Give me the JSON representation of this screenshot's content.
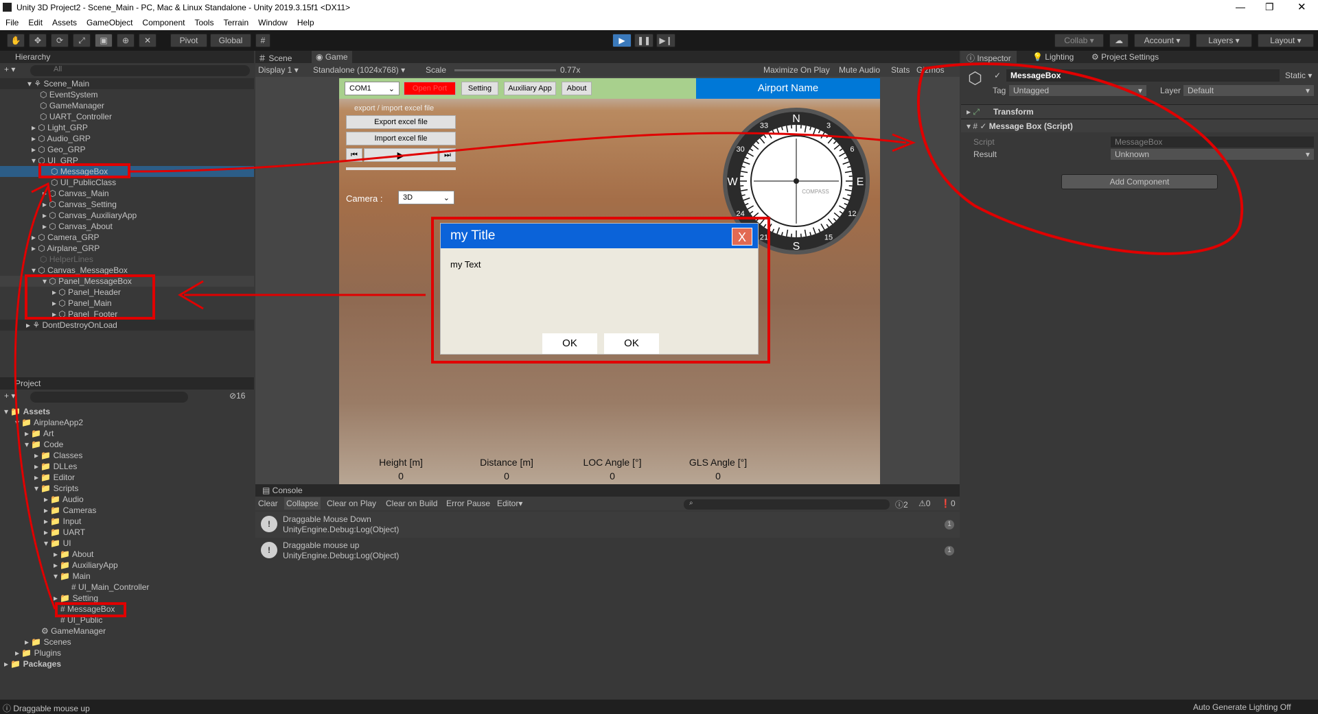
{
  "window": {
    "title": "Unity 3D Project2 - Scene_Main - PC, Mac & Linux Standalone - Unity 2019.3.15f1 <DX11>"
  },
  "menu": [
    "File",
    "Edit",
    "Assets",
    "GameObject",
    "Component",
    "Tools",
    "Terrain",
    "Window",
    "Help"
  ],
  "toolbar": {
    "pivot": "Pivot",
    "global": "Global",
    "collab": "Collab ▾",
    "account": "Account",
    "layers": "Layers",
    "layout": "Layout"
  },
  "hierarchy": {
    "title": "Hierarchy",
    "search": "All",
    "scene": "Scene_Main",
    "items": [
      "EventSystem",
      "GameManager",
      "UART_Controller",
      "Light_GRP",
      "Audio_GRP",
      "Geo_GRP",
      "UI_GRP",
      "MessageBox",
      "UI_PublicClass",
      "Canvas_Main",
      "Canvas_Setting",
      "Canvas_AuxiliaryApp",
      "Canvas_About",
      "Camera_GRP",
      "Airplane_GRP",
      "HelperLines",
      "Canvas_MessageBox",
      "Panel_MessageBox",
      "Panel_Header",
      "Panel_Main",
      "Panel_Footer"
    ],
    "dontdestroy": "DontDestroyOnLoad"
  },
  "project": {
    "title": "Project",
    "count": "16",
    "items": [
      "Assets",
      "AirplaneApp2",
      "Art",
      "Code",
      "Classes",
      "DLLes",
      "Editor",
      "Scripts",
      "Audio",
      "Cameras",
      "Input",
      "UART",
      "UI",
      "About",
      "AuxiliaryApp",
      "Main",
      "UI_Main_Controller",
      "Setting",
      "MessageBox",
      "UI_Public",
      "GameManager",
      "Scenes",
      "Plugins",
      "Packages"
    ]
  },
  "game": {
    "tab_scene": "Scene",
    "tab_game": "Game",
    "display": "Display 1",
    "resolution": "Standalone (1024x768)",
    "scale_label": "Scale",
    "scale_value": "0.77x",
    "maximize": "Maximize On Play",
    "mute": "Mute Audio",
    "stats": "Stats",
    "gizmos": "Gizmos",
    "com": "COM1",
    "open_port": "Open Port",
    "setting": "Setting",
    "aux": "Auxiliary App",
    "about": "About",
    "airport": "Airport Name",
    "excel_title": "export / import excel file",
    "export": "Export excel file",
    "import": "Import excel file",
    "camera_label": "Camera :",
    "camera_value": "3D",
    "msg_title": "my Title",
    "msg_close": "X",
    "msg_text": "my Text",
    "ok1": "OK",
    "ok2": "OK",
    "readouts": [
      {
        "label": "Height [m]",
        "value": "0"
      },
      {
        "label": "Distance [m]",
        "value": "0"
      },
      {
        "label": "LOC Angle [°]",
        "value": "0"
      },
      {
        "label": "GLS Angle [°]",
        "value": "0"
      }
    ],
    "compass": {
      "n": "N",
      "s": "S",
      "e": "E",
      "w": "W",
      "label": "COMPASS",
      "marks": [
        "3",
        "6",
        "12",
        "15",
        "21",
        "24",
        "30",
        "33"
      ]
    }
  },
  "inspector": {
    "tab_inspector": "Inspector",
    "tab_lighting": "Lighting",
    "tab_project": "Project Settings",
    "name": "MessageBox",
    "static": "Static",
    "tag_label": "Tag",
    "tag": "Untagged",
    "layer_label": "Layer",
    "layer": "Default",
    "transform": "Transform",
    "component": "Message Box (Script)",
    "script_label": "Script",
    "script": "MessageBox",
    "result_label": "Result",
    "result": "Unknown",
    "add": "Add Component"
  },
  "console": {
    "title": "Console",
    "clear": "Clear",
    "collapse": "Collapse",
    "clear_play": "Clear on Play",
    "clear_build": "Clear on Build",
    "error_pause": "Error Pause",
    "editor": "Editor",
    "c1": "2",
    "c2": "0",
    "c3": "0",
    "logs": [
      {
        "l1": "Draggable Mouse Down",
        "l2": "UnityEngine.Debug:Log(Object)",
        "n": "1"
      },
      {
        "l1": "Draggable mouse up",
        "l2": "UnityEngine.Debug:Log(Object)",
        "n": "1"
      }
    ]
  },
  "status": {
    "left": "Draggable mouse up",
    "right": "Auto Generate Lighting Off"
  }
}
